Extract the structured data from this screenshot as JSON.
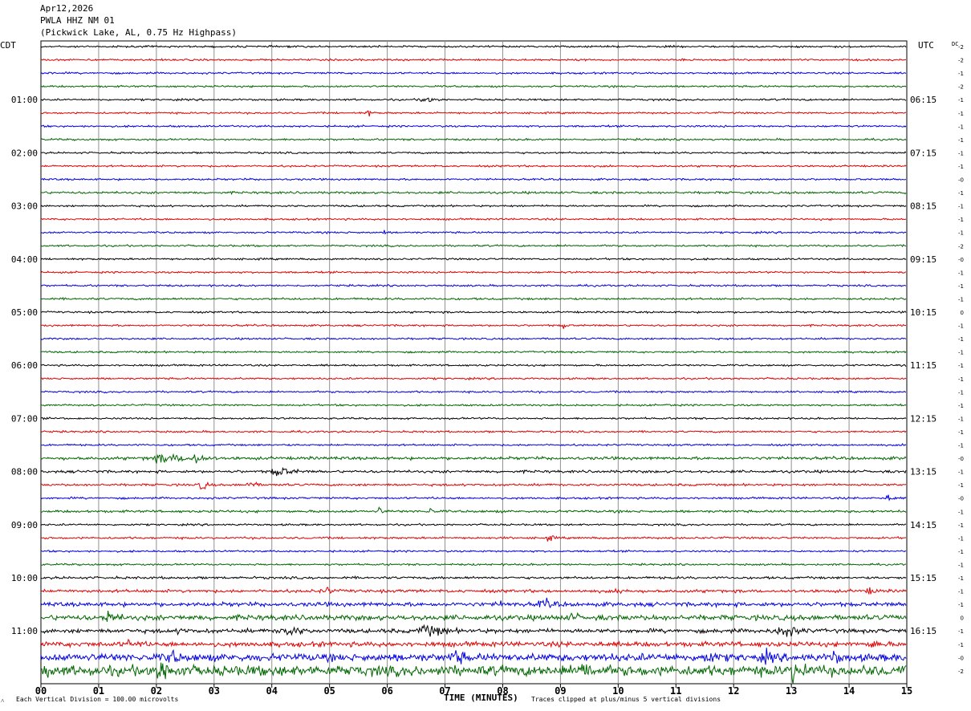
{
  "header": {
    "date": "Apr12,2026",
    "station": "PWLA HHZ NM 01",
    "location": "(Pickwick Lake, AL, 0.75 Hz Highpass)"
  },
  "left_zone_label": "CDT",
  "right_zone_label": "UTC",
  "dc_label": "DC",
  "footer": {
    "scale_note": "Each Vertical Division =  100.00 microvolts",
    "axis_title": "TIME (MINUTES)",
    "clip_note": "Traces clipped at plus/minus 5 vertical divisions",
    "corner_mark": "˄"
  },
  "colors": {
    "trace_cycle": [
      "#000000",
      "#e00000",
      "#0000e0",
      "#006600"
    ],
    "grid": "#909090"
  },
  "chart_data": {
    "type": "line",
    "title": "PWLA HHZ NM 01",
    "xlabel": "TIME (MINUTES)",
    "xlim": [
      0,
      15
    ],
    "x_ticks": [
      "00",
      "01",
      "02",
      "03",
      "04",
      "05",
      "06",
      "07",
      "08",
      "09",
      "10",
      "11",
      "12",
      "13",
      "14",
      "15"
    ],
    "trace_count": 48,
    "left_hour_labels": [
      {
        "trace": 4,
        "label": "01:00"
      },
      {
        "trace": 8,
        "label": "02:00"
      },
      {
        "trace": 12,
        "label": "03:00"
      },
      {
        "trace": 16,
        "label": "04:00"
      },
      {
        "trace": 20,
        "label": "05:00"
      },
      {
        "trace": 24,
        "label": "06:00"
      },
      {
        "trace": 28,
        "label": "07:00"
      },
      {
        "trace": 32,
        "label": "08:00"
      },
      {
        "trace": 36,
        "label": "09:00"
      },
      {
        "trace": 40,
        "label": "10:00"
      },
      {
        "trace": 44,
        "label": "11:00"
      }
    ],
    "right_hour_labels": [
      {
        "trace": 4,
        "label": "06:15"
      },
      {
        "trace": 8,
        "label": "07:15"
      },
      {
        "trace": 12,
        "label": "08:15"
      },
      {
        "trace": 16,
        "label": "09:15"
      },
      {
        "trace": 20,
        "label": "10:15"
      },
      {
        "trace": 24,
        "label": "11:15"
      },
      {
        "trace": 28,
        "label": "12:15"
      },
      {
        "trace": 32,
        "label": "13:15"
      },
      {
        "trace": 36,
        "label": "14:15"
      },
      {
        "trace": 40,
        "label": "15:15"
      },
      {
        "trace": 44,
        "label": "16:15"
      }
    ],
    "dc_offsets": [
      "-2",
      "-2",
      "-1",
      "-2",
      "-1",
      "-1",
      "-1",
      "-1",
      "-1",
      "-1",
      "-0",
      "-1",
      "-1",
      "-1",
      "-1",
      "-2",
      "-0",
      "-1",
      "-1",
      "-1",
      "0",
      "-1",
      "-1",
      "-1",
      "-1",
      "-1",
      "-1",
      "-1",
      "-1",
      "-1",
      "-1",
      "-0",
      "-1",
      "-1",
      "-0",
      "-1",
      "-1",
      "-1",
      "-1",
      "-1",
      "-1",
      "-1",
      "-1",
      "0",
      "-1",
      "-1",
      "-0",
      "-2"
    ],
    "noise_level": [
      1,
      1,
      1,
      1,
      1,
      1,
      1,
      1,
      1,
      1,
      1,
      1.2,
      1,
      1,
      1,
      1,
      1,
      1,
      1,
      1.1,
      1,
      1,
      1,
      1,
      1,
      1,
      1,
      1,
      1,
      1,
      1,
      1.6,
      1.4,
      1.2,
      1.1,
      1.3,
      1,
      1.1,
      1,
      1,
      1.3,
      1.6,
      2.2,
      2.8,
      2.2,
      2.6,
      4,
      5.5
    ],
    "events": [
      {
        "trace": 4,
        "start_min": 6.5,
        "duration_min": 0.7,
        "amp": 4
      },
      {
        "trace": 5,
        "start_min": 5.6,
        "duration_min": 0.3,
        "amp": 4
      },
      {
        "trace": 14,
        "start_min": 5.9,
        "duration_min": 0.1,
        "amp": 8
      },
      {
        "trace": 19,
        "start_min": 3.85,
        "duration_min": 0.1,
        "amp": 7
      },
      {
        "trace": 21,
        "start_min": 9.0,
        "duration_min": 0.2,
        "amp": 5
      },
      {
        "trace": 27,
        "start_min": 10.8,
        "duration_min": 0.3,
        "amp": 3
      },
      {
        "trace": 31,
        "start_min": 1.6,
        "duration_min": 2.6,
        "amp": 5
      },
      {
        "trace": 31,
        "start_min": 2.6,
        "duration_min": 0.4,
        "amp": 9
      },
      {
        "trace": 32,
        "start_min": 3.9,
        "duration_min": 1.0,
        "amp": 6
      },
      {
        "trace": 33,
        "start_min": 2.7,
        "duration_min": 0.4,
        "amp": 6
      },
      {
        "trace": 33,
        "start_min": 3.5,
        "duration_min": 0.5,
        "amp": 5
      },
      {
        "trace": 34,
        "start_min": 14.6,
        "duration_min": 0.4,
        "amp": 4
      },
      {
        "trace": 35,
        "start_min": 5.8,
        "duration_min": 0.3,
        "amp": 5
      },
      {
        "trace": 35,
        "start_min": 6.7,
        "duration_min": 0.2,
        "amp": 6
      },
      {
        "trace": 37,
        "start_min": 8.7,
        "duration_min": 0.4,
        "amp": 4
      },
      {
        "trace": 41,
        "start_min": 4.8,
        "duration_min": 0.6,
        "amp": 5
      },
      {
        "trace": 41,
        "start_min": 9.9,
        "duration_min": 0.7,
        "amp": 4
      },
      {
        "trace": 41,
        "start_min": 14.2,
        "duration_min": 0.7,
        "amp": 4
      },
      {
        "trace": 42,
        "start_min": 7.9,
        "duration_min": 0.4,
        "amp": 5
      },
      {
        "trace": 42,
        "start_min": 8.5,
        "duration_min": 1.0,
        "amp": 6
      },
      {
        "trace": 43,
        "start_min": 1.0,
        "duration_min": 0.8,
        "amp": 8
      },
      {
        "trace": 43,
        "start_min": 9.1,
        "duration_min": 0.5,
        "amp": 7
      },
      {
        "trace": 44,
        "start_min": 2.3,
        "duration_min": 0.6,
        "amp": 5
      },
      {
        "trace": 44,
        "start_min": 4.0,
        "duration_min": 1.2,
        "amp": 6
      },
      {
        "trace": 44,
        "start_min": 6.4,
        "duration_min": 1.4,
        "amp": 7
      },
      {
        "trace": 44,
        "start_min": 12.6,
        "duration_min": 1.2,
        "amp": 7
      },
      {
        "trace": 45,
        "start_min": 1.4,
        "duration_min": 0.8,
        "amp": 6
      },
      {
        "trace": 45,
        "start_min": 14.3,
        "duration_min": 0.6,
        "amp": 6
      },
      {
        "trace": 46,
        "start_min": 2.1,
        "duration_min": 0.7,
        "amp": 10
      },
      {
        "trace": 46,
        "start_min": 7.0,
        "duration_min": 0.9,
        "amp": 9
      },
      {
        "trace": 46,
        "start_min": 11.3,
        "duration_min": 1.0,
        "amp": 8
      },
      {
        "trace": 46,
        "start_min": 12.4,
        "duration_min": 0.8,
        "amp": 8
      },
      {
        "trace": 46,
        "start_min": 13.6,
        "duration_min": 0.6,
        "amp": 10
      },
      {
        "trace": 47,
        "start_min": 0.0,
        "duration_min": 0.4,
        "amp": 12
      },
      {
        "trace": 47,
        "start_min": 1.8,
        "duration_min": 1.4,
        "amp": 12
      },
      {
        "trace": 47,
        "start_min": 9.2,
        "duration_min": 0.8,
        "amp": 14
      },
      {
        "trace": 47,
        "start_min": 12.8,
        "duration_min": 1.2,
        "amp": 12
      }
    ]
  }
}
